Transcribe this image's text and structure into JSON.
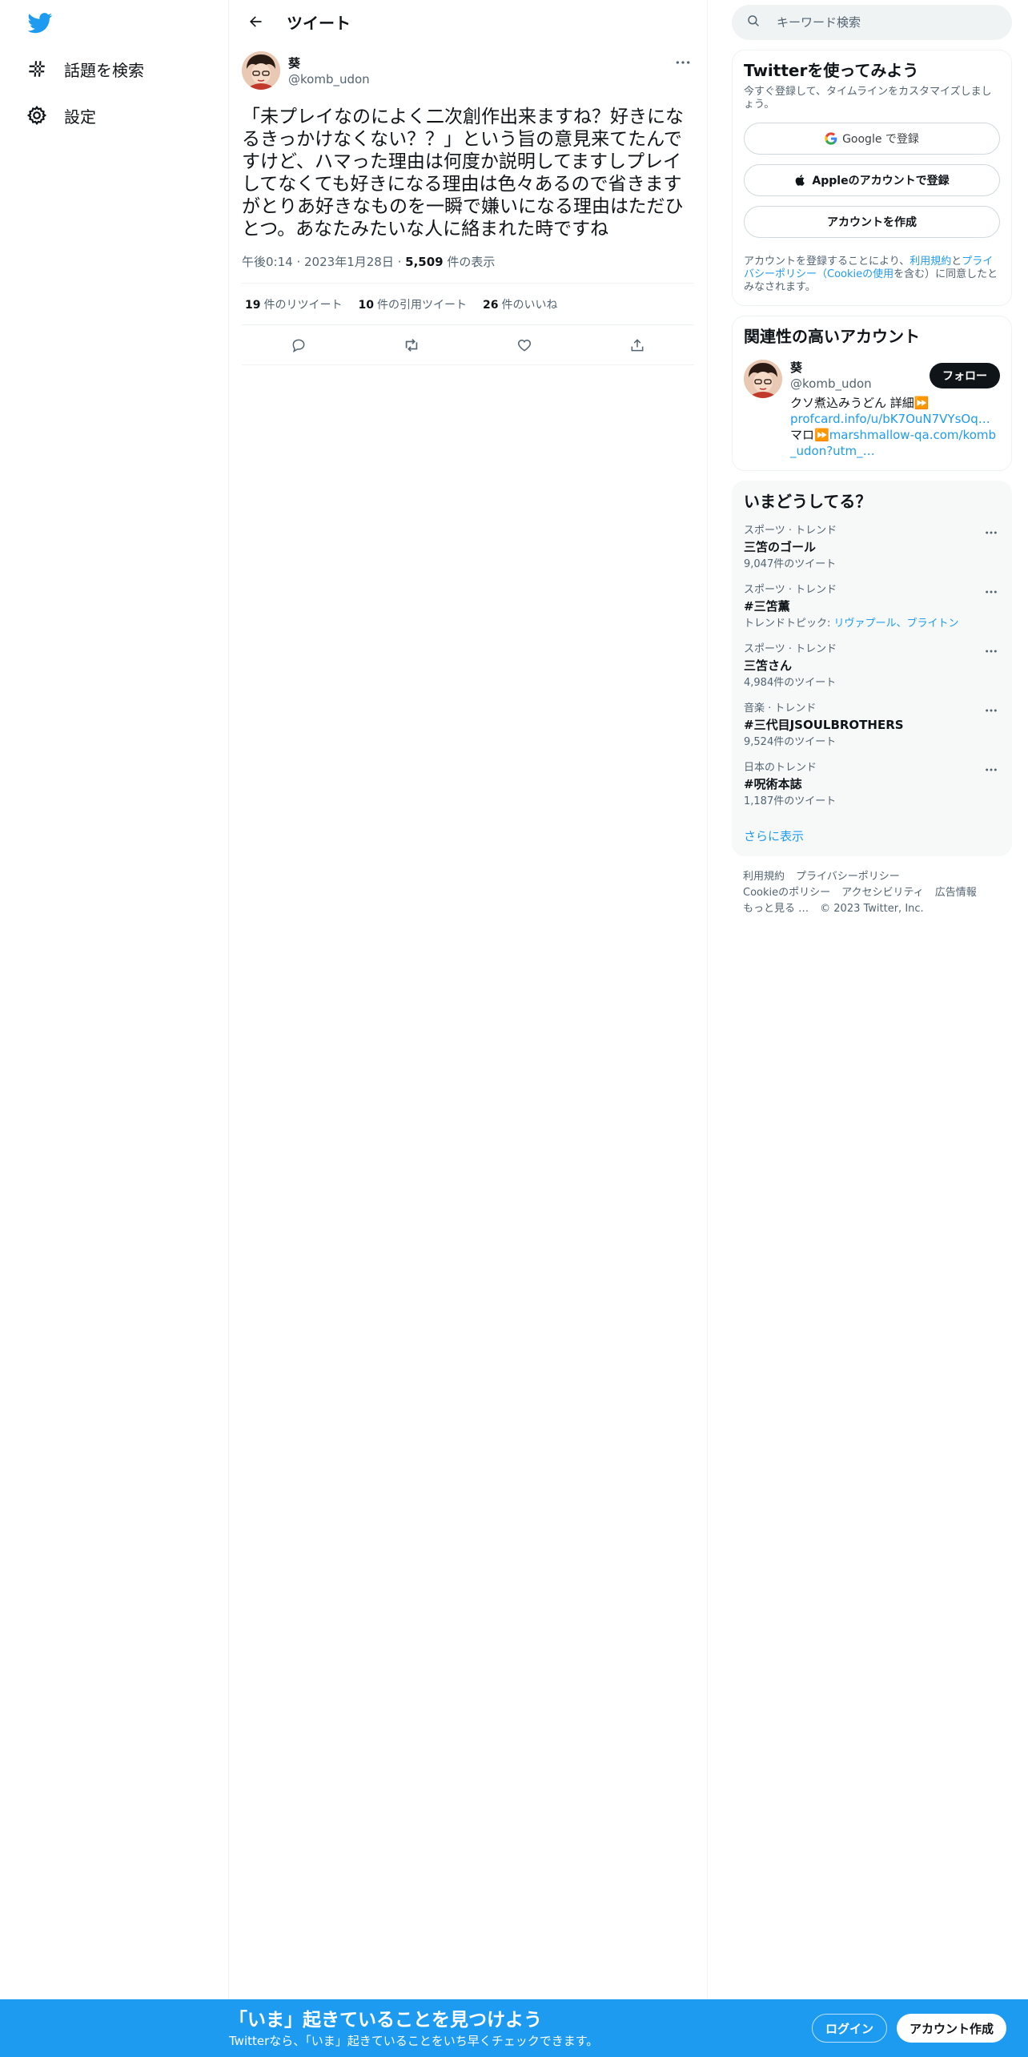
{
  "nav": {
    "items": [
      {
        "label": "話題を検索"
      },
      {
        "label": "設定"
      }
    ]
  },
  "header": {
    "title": "ツイート"
  },
  "tweet": {
    "author_name": "葵",
    "author_handle": "@komb_udon",
    "text": "「未プレイなのによく二次創作出来ますね？好きになるきっかけなくない？？」という旨の意見来てたんですけど、ハマった理由は何度か説明してますしプレイしてなくても好きになる理由は色々あるので省きますがとりあ好きなものを一瞬で嫌いになる理由はただひとつ。あなたみたいな人に絡まれた時ですね",
    "time": "午後0:14",
    "date": "2023年1月28日",
    "views_count": "5,509",
    "views_label": "件の表示",
    "retweets_count": "19",
    "retweets_label": "件のリツイート",
    "quotes_count": "10",
    "quotes_label": "件の引用ツイート",
    "likes_count": "26",
    "likes_label": "件のいいね"
  },
  "search": {
    "placeholder": "キーワード検索"
  },
  "signup_card": {
    "title": "Twitterを使ってみよう",
    "subtitle": "今すぐ登録して、タイムラインをカスタマイズしましょう。",
    "google_label": "Google で登録",
    "apple_label": "Appleのアカウントで登録",
    "create_label": "アカウントを作成",
    "terms_prefix": "アカウントを登録することにより、",
    "terms_link": "利用規約",
    "terms_mid": "と",
    "privacy_link": "プライバシーポリシー（Cookieの使用",
    "terms_suffix": "を含む）に同意したとみなされます。"
  },
  "related": {
    "title": "関連性の高いアカウント",
    "name": "葵",
    "handle": "@komb_udon",
    "follow_label": "フォロー",
    "bio_text": "クソ煮込みうどん 詳細⏩",
    "bio_link1": "profcard.info/u/bK7OuN7VYsOq…",
    "bio_mid": " マロ⏩",
    "bio_link2": "marshmallow-qa.com/komb_udon?utm_…"
  },
  "trends": {
    "title": "いまどうしてる？",
    "items": [
      {
        "category": "スポーツ · トレンド",
        "name": "三笘のゴール",
        "count": "9,047件のツイート"
      },
      {
        "category": "スポーツ · トレンド",
        "name": "#三笘薫",
        "topic_prefix": "トレンドトピック: ",
        "topic_links": "リヴァプール、ブライトン"
      },
      {
        "category": "スポーツ · トレンド",
        "name": "三笘さん",
        "count": "4,984件のツイート"
      },
      {
        "category": "音楽 · トレンド",
        "name": "#三代目JSOULBROTHERS",
        "count": "9,524件のツイート"
      },
      {
        "category": "日本のトレンド",
        "name": "#呪術本誌",
        "count": "1,187件のツイート"
      }
    ],
    "show_more": "さらに表示"
  },
  "footer": {
    "links": [
      "利用規約",
      "プライバシーポリシー",
      "Cookieのポリシー",
      "アクセシビリティ",
      "広告情報",
      "もっと見る …"
    ],
    "copyright": "© 2023 Twitter, Inc."
  },
  "bottom_bar": {
    "title": "「いま」起きていることを見つけよう",
    "subtitle": "Twitterなら、「いま」起きていることをいち早くチェックできます。",
    "login_label": "ログイン",
    "signup_label": "アカウント作成"
  },
  "colors": {
    "brand": "#1d9bf0",
    "text": "#0f1419",
    "muted": "#536471"
  }
}
